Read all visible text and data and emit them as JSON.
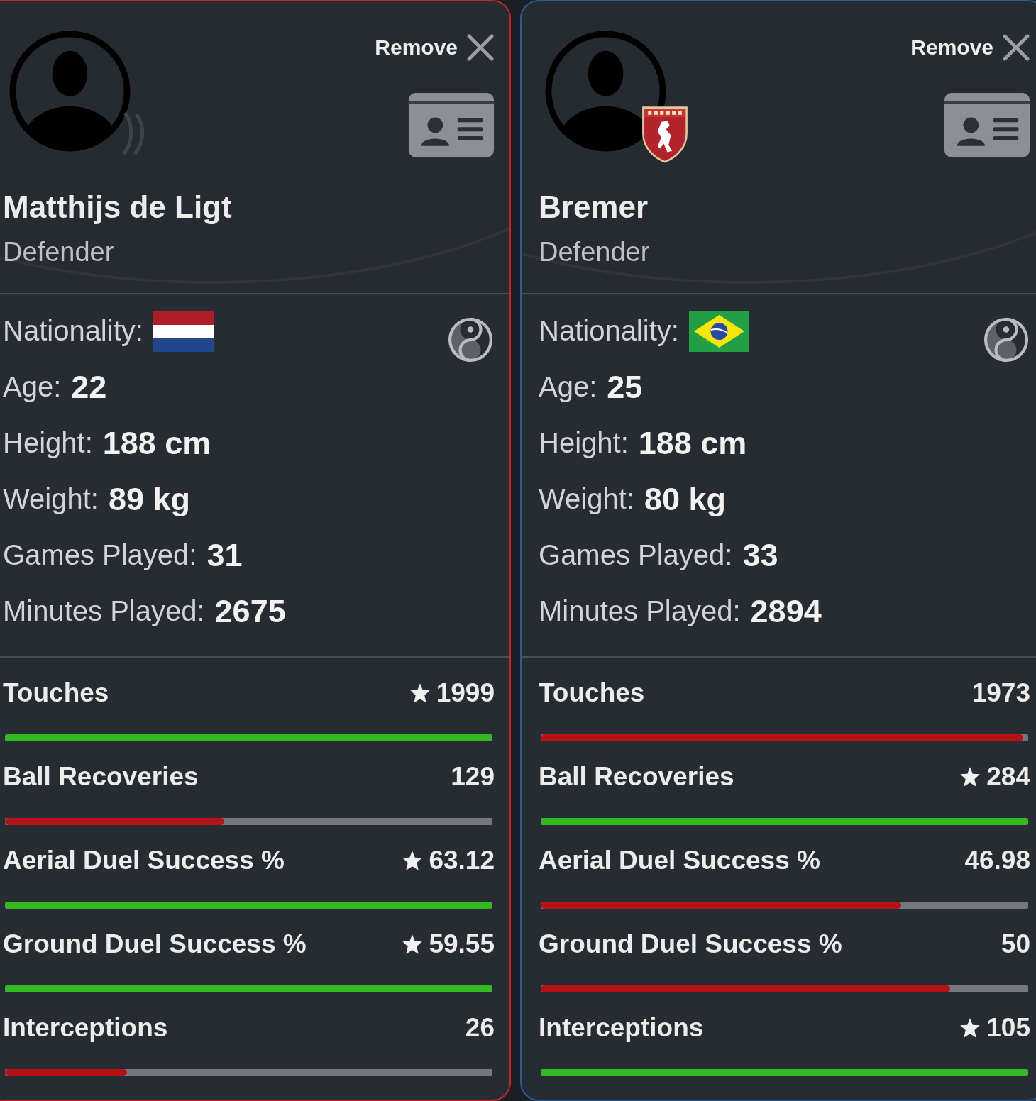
{
  "players": [
    {
      "color": "#c0282f",
      "remove_label": "Remove",
      "badge": {
        "kind": "arcs"
      },
      "name": "Matthijs de Ligt",
      "position": "Defender",
      "details": [
        {
          "kind": "flag",
          "label": "Nationality:",
          "flag": {
            "kind": "netherlands"
          }
        },
        {
          "kind": "text",
          "label": "Age:",
          "value": "22"
        },
        {
          "kind": "text",
          "label": "Height:",
          "value": "188 cm"
        },
        {
          "kind": "text",
          "label": "Weight:",
          "value": "89 kg"
        },
        {
          "kind": "text",
          "label": "Games Played:",
          "value": "31"
        },
        {
          "kind": "text",
          "label": "Minutes Played:",
          "value": "2675"
        }
      ],
      "stats": [
        {
          "label": "Touches",
          "value": "1999",
          "starred": true,
          "level": 1
        },
        {
          "label": "Ball Recoveries",
          "value": "129",
          "starred": false,
          "level": 0.45
        },
        {
          "label": "Aerial Duel Success %",
          "value": "63.12",
          "starred": true,
          "level": 1
        },
        {
          "label": "Ground Duel Success %",
          "value": "59.55",
          "starred": true,
          "level": 1
        },
        {
          "label": "Interceptions",
          "value": "26",
          "starred": false,
          "level": 0.25
        }
      ]
    },
    {
      "color": "#2b5c93",
      "remove_label": "Remove",
      "badge": {
        "kind": "shield"
      },
      "name": "Bremer",
      "position": "Defender",
      "details": [
        {
          "kind": "flag",
          "label": "Nationality:",
          "flag": {
            "kind": "brazil"
          }
        },
        {
          "kind": "text",
          "label": "Age:",
          "value": "25"
        },
        {
          "kind": "text",
          "label": "Height:",
          "value": "188 cm"
        },
        {
          "kind": "text",
          "label": "Weight:",
          "value": "80 kg"
        },
        {
          "kind": "text",
          "label": "Games Played:",
          "value": "33"
        },
        {
          "kind": "text",
          "label": "Minutes Played:",
          "value": "2894"
        }
      ],
      "stats": [
        {
          "label": "Touches",
          "value": "1973",
          "starred": false,
          "level": 0.99
        },
        {
          "label": "Ball Recoveries",
          "value": "284",
          "starred": true,
          "level": 1
        },
        {
          "label": "Aerial Duel Success %",
          "value": "46.98",
          "starred": false,
          "level": 0.74
        },
        {
          "label": "Ground Duel Success %",
          "value": "50",
          "starred": false,
          "level": 0.84
        },
        {
          "label": "Interceptions",
          "value": "105",
          "starred": true,
          "level": 1
        }
      ]
    }
  ]
}
